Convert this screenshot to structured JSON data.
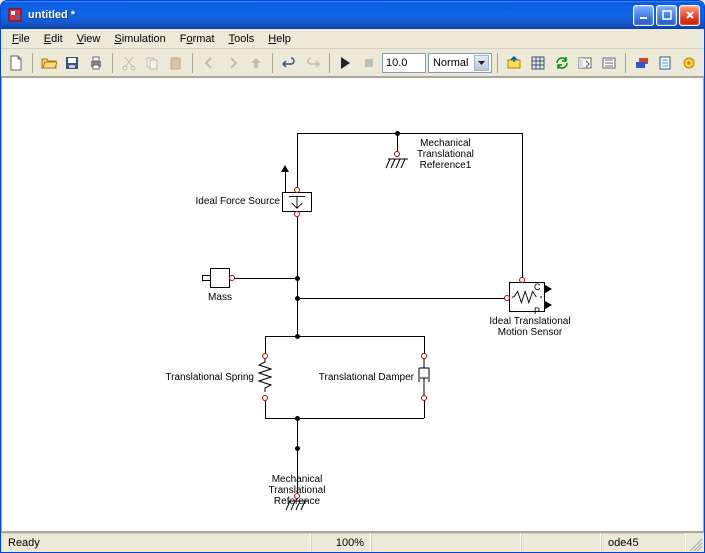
{
  "window": {
    "title": "untitled *"
  },
  "menu": {
    "items": [
      {
        "label": "File",
        "u": "F"
      },
      {
        "label": "Edit",
        "u": "E"
      },
      {
        "label": "View",
        "u": "V"
      },
      {
        "label": "Simulation",
        "u": "S"
      },
      {
        "label": "Format",
        "u": "o"
      },
      {
        "label": "Tools",
        "u": "T"
      },
      {
        "label": "Help",
        "u": "H"
      }
    ]
  },
  "toolbar": {
    "stop_time": "10.0",
    "mode_selected": "Normal"
  },
  "blocks": {
    "mech_ref1": "Mechanical\nTranslational\nReference1",
    "ideal_force": "Ideal Force Source",
    "mass": "Mass",
    "spring": "Translational Spring",
    "damper": "Translational Damper",
    "mech_ref": "Mechanical\nTranslational\nReference",
    "motion_sensor": "Ideal Translational\nMotion Sensor",
    "sensor_port_c": "C",
    "sensor_port_p": "P"
  },
  "status": {
    "ready": "Ready",
    "zoom": "100%",
    "solver": "ode45"
  },
  "colors": {
    "wire": "#000000",
    "port": "#cc0000",
    "xp_blue": "#0b5ae2"
  }
}
